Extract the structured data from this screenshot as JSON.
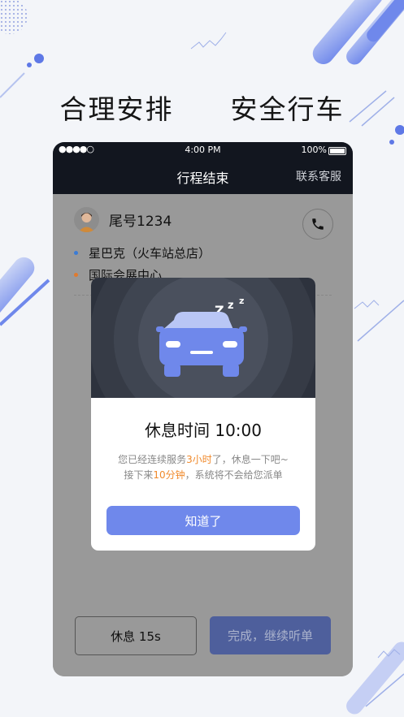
{
  "headline": {
    "left": "合理安排",
    "right": "安全行车"
  },
  "status_bar": {
    "signal": "●●●●○",
    "time": "4:00 PM",
    "battery": "100%"
  },
  "nav": {
    "title": "行程结束",
    "contact": "联系客服"
  },
  "trip": {
    "plate": "尾号1234",
    "origin": "星巴克（火车站总店）",
    "destination": "国际会展中心",
    "origin_dot_color": "#3a7bd5",
    "destination_dot_color": "#e07a2e"
  },
  "modal": {
    "title": "休息时间 10:00",
    "zzz": "Z z z",
    "line1_pre": "您已经连续服务",
    "line1_hl": "3小时",
    "line1_post": "了，休息一下吧~",
    "line2_pre": "接下来",
    "line2_hl": "10分钟",
    "line2_post": "，系统将不会给您派单",
    "ok": "知道了"
  },
  "buttons": {
    "rest": "休息 15s",
    "done": "完成，继续听单"
  },
  "colors": {
    "accent": "#6f88eb",
    "highlight": "#f08a2c",
    "dark": "#12161f"
  }
}
